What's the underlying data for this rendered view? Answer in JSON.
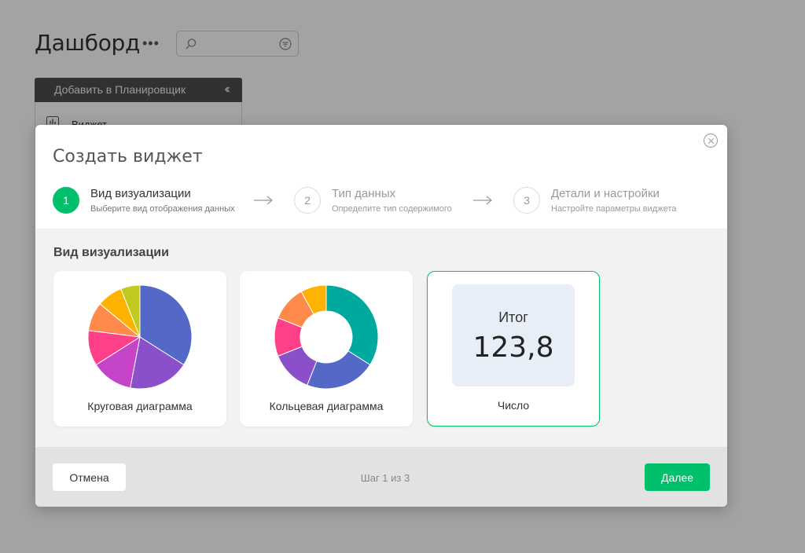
{
  "page": {
    "title": "Дашборд",
    "more_icon": "ellipsis-icon",
    "search": {
      "placeholder": "",
      "icon": "search-icon",
      "filter_icon": "filter-icon"
    },
    "planner_bar": {
      "label": "Добавить в Планировщик",
      "collapse_icon": "double-chevron-left-icon"
    },
    "widget_item": {
      "label": "Виджет",
      "icon": "bar-chart-icon"
    }
  },
  "modal": {
    "title": "Создать виджет",
    "close_icon": "close-circle-icon",
    "steps": [
      {
        "number": "1",
        "title": "Вид визуализации",
        "subtitle": "Выберите вид отображения данных",
        "active": true
      },
      {
        "number": "2",
        "title": "Тип данных",
        "subtitle": "Определите тип содержимого",
        "active": false
      },
      {
        "number": "3",
        "title": "Детали и настройки",
        "subtitle": "Настройте параметры виджета",
        "active": false
      }
    ],
    "section_title": "Вид визуализации",
    "cards": [
      {
        "label": "Круговая диаграмма",
        "type": "pie",
        "selected": false
      },
      {
        "label": "Кольцевая диаграмма",
        "type": "donut",
        "selected": false
      },
      {
        "label": "Число",
        "type": "number",
        "selected": true,
        "kpi_title": "Итог",
        "kpi_value": "123,8"
      }
    ],
    "footer": {
      "cancel_label": "Отмена",
      "step_indicator": "Шаг 1 из 3",
      "next_label": "Далее"
    }
  },
  "colors": {
    "accent": "#00c06b",
    "pie_slices": [
      "#5468c7",
      "#8a4fc9",
      "#c644c7",
      "#ff3f87",
      "#ff8a4c",
      "#ffb300",
      "#bfcc1f"
    ],
    "donut_segments": [
      "#00a99d",
      "#5468c7",
      "#8a4fc9",
      "#ff3f87",
      "#ff8a4c",
      "#ffb300"
    ]
  },
  "chart_data": [
    {
      "type": "pie",
      "values": [
        34,
        19,
        13,
        11,
        9,
        8,
        6
      ]
    },
    {
      "type": "pie",
      "values": [
        34,
        22,
        13,
        12,
        11,
        8
      ]
    }
  ]
}
